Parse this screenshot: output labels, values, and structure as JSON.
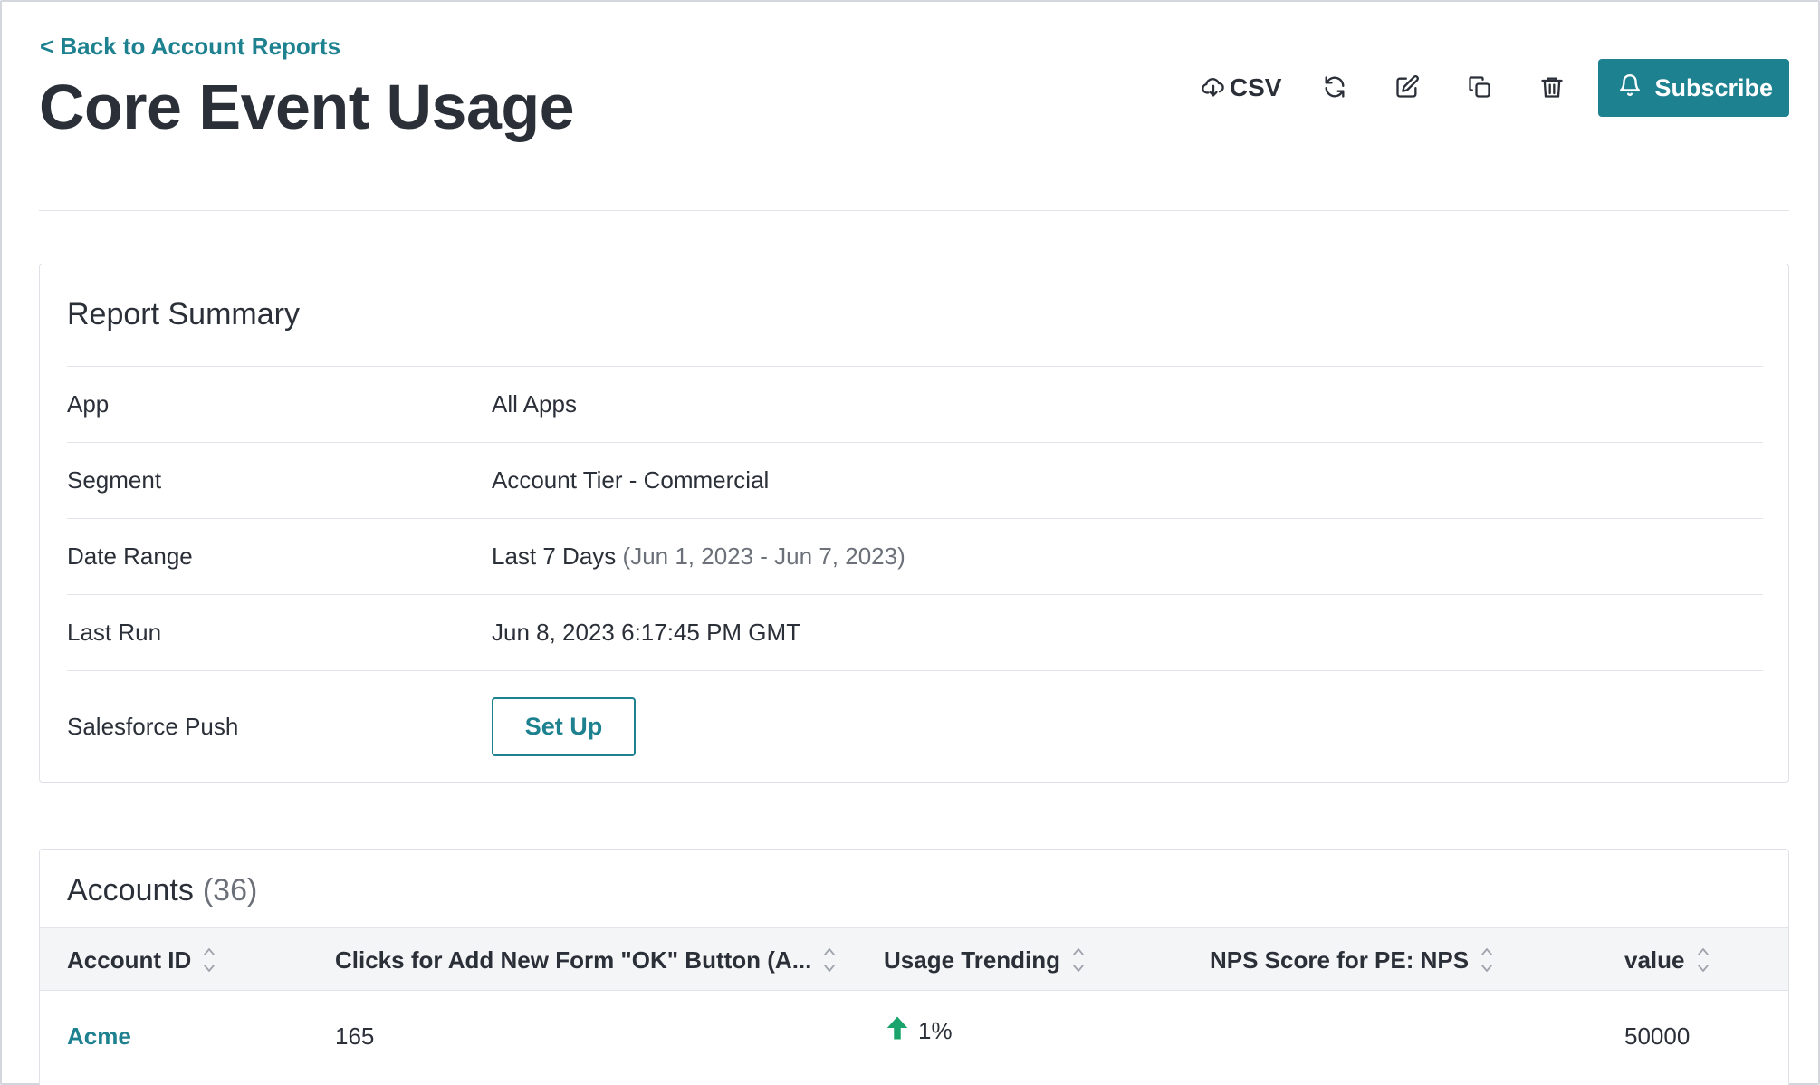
{
  "header": {
    "back_link": "< Back to Account Reports",
    "title": "Core Event Usage"
  },
  "toolbar": {
    "csv_label": "CSV",
    "subscribe_label": "Subscribe",
    "icons": [
      "cloud-download-icon",
      "refresh-icon",
      "edit-icon",
      "copy-icon",
      "trash-icon",
      "bell-icon"
    ]
  },
  "summary": {
    "title": "Report Summary",
    "rows": [
      {
        "label": "App",
        "value": "All Apps"
      },
      {
        "label": "Segment",
        "value": "Account Tier - Commercial"
      },
      {
        "label": "Date Range",
        "value": "Last 7 Days",
        "detail": "(Jun 1, 2023 - Jun 7, 2023)"
      },
      {
        "label": "Last Run",
        "value": "Jun 8, 2023 6:17:45 PM GMT"
      },
      {
        "label": "Salesforce Push",
        "button": "Set Up"
      }
    ]
  },
  "accounts": {
    "title": "Accounts",
    "count": "(36)",
    "columns": [
      "Account ID",
      "Clicks for Add New Form \"OK\" Button (A...",
      "Usage Trending",
      "NPS Score for PE: NPS",
      "value"
    ],
    "rows": [
      {
        "account_id": "Acme",
        "clicks": "165",
        "trend": "1%",
        "trend_direction": "up",
        "nps": "",
        "value": "50000"
      }
    ]
  },
  "colors": {
    "accent": "#1e8190",
    "trend_up": "#1aa36b",
    "text": "#2a2f38"
  }
}
